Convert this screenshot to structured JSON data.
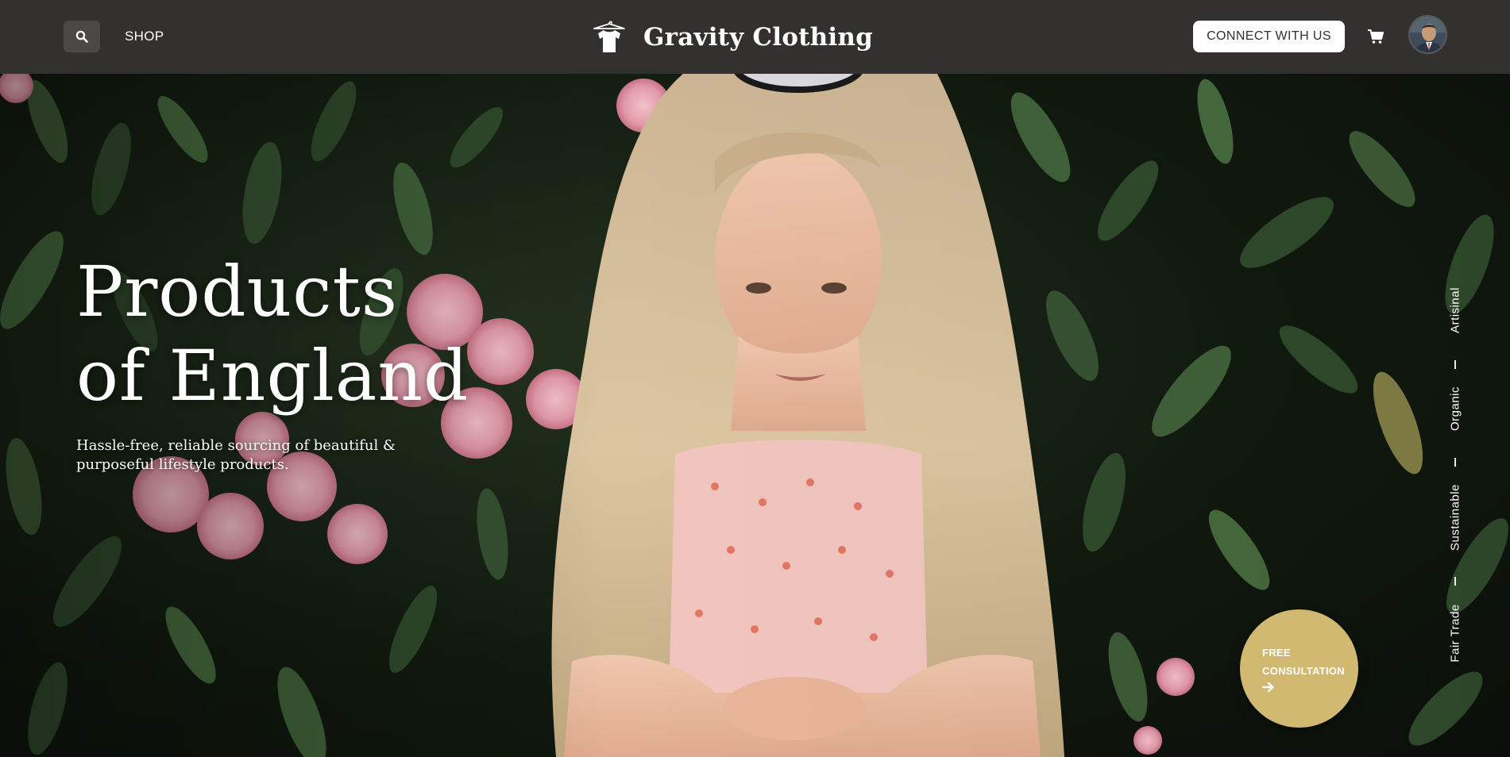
{
  "header": {
    "shop_label": "SHOP",
    "brand_name": "Gravity Clothing",
    "connect_label": "CONNECT WITH US"
  },
  "hero": {
    "title_line1": "Products",
    "title_line2": "of England",
    "subtitle": "Hassle-free, reliable sourcing of beautiful & purposeful lifestyle products.",
    "tags": [
      "Artisinal",
      "Organic",
      "Sustainable",
      "Fair Trade"
    ],
    "consult_line1": "FREE",
    "consult_line2": "CONSULTATION"
  },
  "icons": {
    "search": "search-icon",
    "logo": "tshirt-hanger-logo",
    "cart": "cart-icon",
    "avatar": "user-avatar",
    "arrow": "arrow-right-icon"
  },
  "colors": {
    "header_bg": "#333130",
    "search_bg": "#4b4948",
    "accent_gold": "#d1b972",
    "text_light": "#ffffff"
  }
}
